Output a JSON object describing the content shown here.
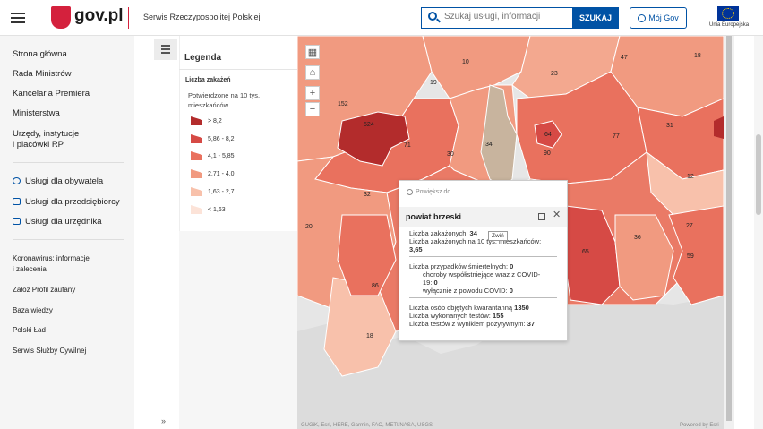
{
  "header": {
    "logo_text": "gov.pl",
    "service_name": "Serwis Rzeczypospolitej Polskiej",
    "search_placeholder": "Szukaj usługi, informacji",
    "search_button": "SZUKAJ",
    "account_button": "Mój Gov",
    "eu_label": "Unia Europejska"
  },
  "nav": {
    "items": [
      "Strona główna",
      "Rada Ministrów",
      "Kancelaria Premiera",
      "Ministerstwa",
      "Urzędy, instytucje",
      "i placówki RP"
    ],
    "services": [
      "Usługi dla obywatela",
      "Usługi dla przedsiębiorcy",
      "Usługi dla urzędnika"
    ],
    "links": [
      "Koronawirus: informacje",
      "i zalecenia",
      "Załóż Profil zaufany",
      "Baza wiedzy",
      "Polski Ład",
      "Serwis Służby Cywilnej"
    ]
  },
  "legend": {
    "title": "Legenda",
    "subtitle": "Liczba zakażeń",
    "description": "Potwierdzone na 10 tys. mieszkańców",
    "classes": [
      {
        "label": "> 8,2",
        "color": "#b32c2c"
      },
      {
        "label": "5,86 - 8,2",
        "color": "#d64a45"
      },
      {
        "label": "4,1 - 5,85",
        "color": "#e9715e"
      },
      {
        "label": "2,71 - 4,0",
        "color": "#f19a80"
      },
      {
        "label": "1,63 - 2,7",
        "color": "#f8c1ab"
      },
      {
        "label": "< 1,63",
        "color": "#fce3d8"
      }
    ],
    "collapse_glyph": "»"
  },
  "map": {
    "labels": [
      "10",
      "47",
      "18",
      "23",
      "19",
      "152",
      "524",
      "71",
      "34",
      "64",
      "77",
      "31",
      "30",
      "90",
      "12",
      "32",
      "20",
      "27",
      "36",
      "65",
      "59",
      "86",
      "18"
    ],
    "attribution": "GUGiK, Esri, HERE, Garmin, FAO, METI/NASA, USGS",
    "powered_by": "Powered by Esri"
  },
  "popup": {
    "search_placeholder": "Powiększ do",
    "title": "powiat brzeski",
    "tooltip": "Zwiń",
    "lines": {
      "cases_label": "Liczba zakażonych:",
      "cases_value": "34",
      "per10k_label": "Liczba zakażonych na 10 tys. mieszkańców:",
      "per10k_value": "3,65",
      "deaths_label": "Liczba przypadków śmiertelnych:",
      "deaths_value": "0",
      "comorb_label": "choroby współistniejące wraz z COVID-",
      "comorb_label2": "19:",
      "comorb_value": "0",
      "covid_only_label": "wyłącznie z powodu COVID:",
      "covid_only_value": "0",
      "quarantine_label": "Liczba osób objętych kwarantanną",
      "quarantine_value": "1350",
      "tests_label": "Liczba wykonanych testów:",
      "tests_value": "155",
      "positive_label": "Liczba testów z wynikiem pozytywnym:",
      "positive_value": "37"
    }
  }
}
